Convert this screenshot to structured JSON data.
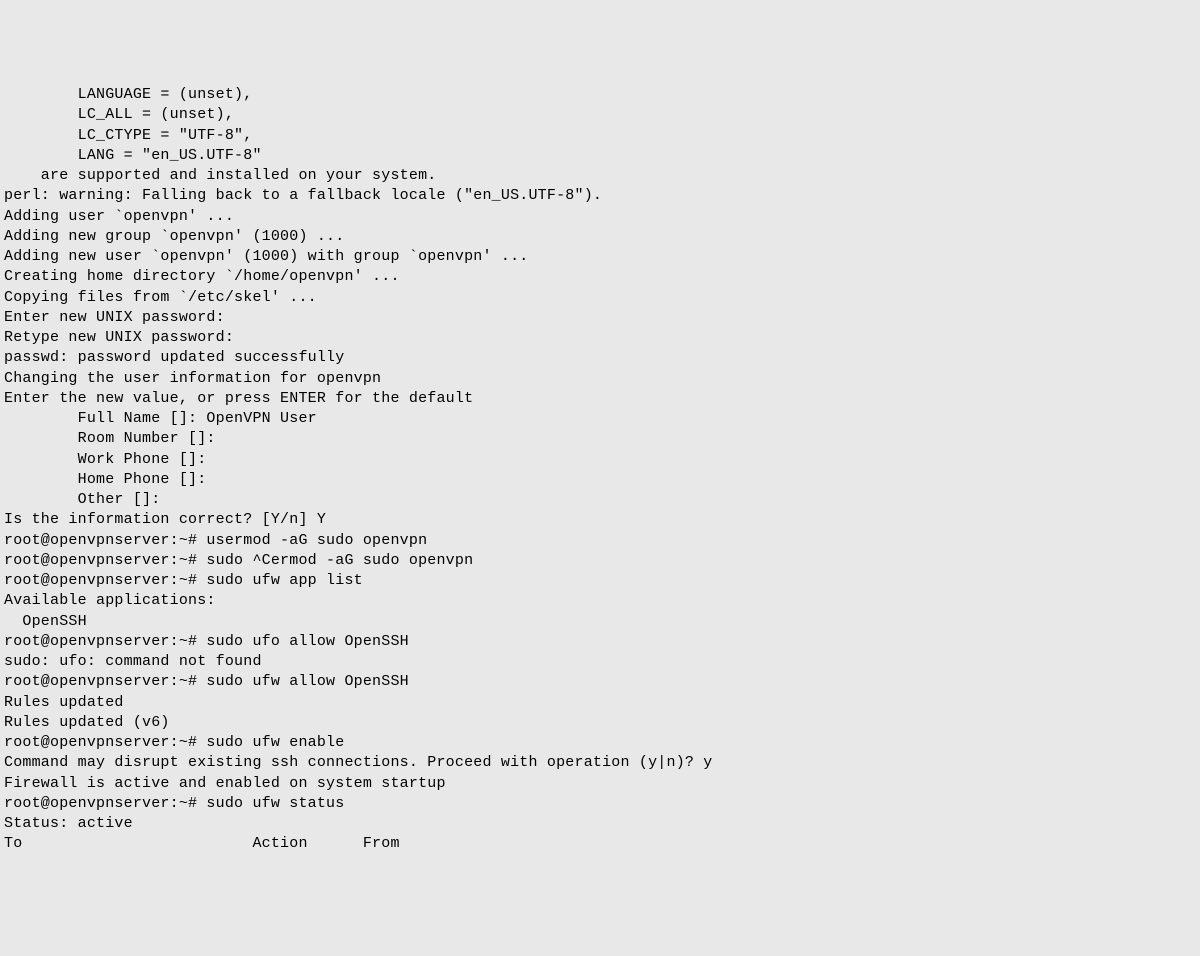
{
  "terminal": {
    "lines": [
      "        LANGUAGE = (unset),",
      "        LC_ALL = (unset),",
      "        LC_CTYPE = \"UTF-8\",",
      "        LANG = \"en_US.UTF-8\"",
      "    are supported and installed on your system.",
      "perl: warning: Falling back to a fallback locale (\"en_US.UTF-8\").",
      "Adding user `openvpn' ...",
      "Adding new group `openvpn' (1000) ...",
      "Adding new user `openvpn' (1000) with group `openvpn' ...",
      "Creating home directory `/home/openvpn' ...",
      "Copying files from `/etc/skel' ...",
      "Enter new UNIX password:",
      "Retype new UNIX password:",
      "passwd: password updated successfully",
      "Changing the user information for openvpn",
      "Enter the new value, or press ENTER for the default",
      "        Full Name []: OpenVPN User",
      "        Room Number []:",
      "        Work Phone []:",
      "        Home Phone []:",
      "        Other []:",
      "Is the information correct? [Y/n] Y",
      "root@openvpnserver:~# usermod -aG sudo openvpn",
      "root@openvpnserver:~# sudo ^Cermod -aG sudo openvpn",
      "root@openvpnserver:~# sudo ufw app list",
      "Available applications:",
      "  OpenSSH",
      "root@openvpnserver:~# sudo ufo allow OpenSSH",
      "sudo: ufo: command not found",
      "root@openvpnserver:~# sudo ufw allow OpenSSH",
      "Rules updated",
      "Rules updated (v6)",
      "root@openvpnserver:~# sudo ufw enable",
      "Command may disrupt existing ssh connections. Proceed with operation (y|n)? y",
      "Firewall is active and enabled on system startup",
      "root@openvpnserver:~# sudo ufw status",
      "Status: active",
      "",
      "To                         Action      From"
    ]
  }
}
